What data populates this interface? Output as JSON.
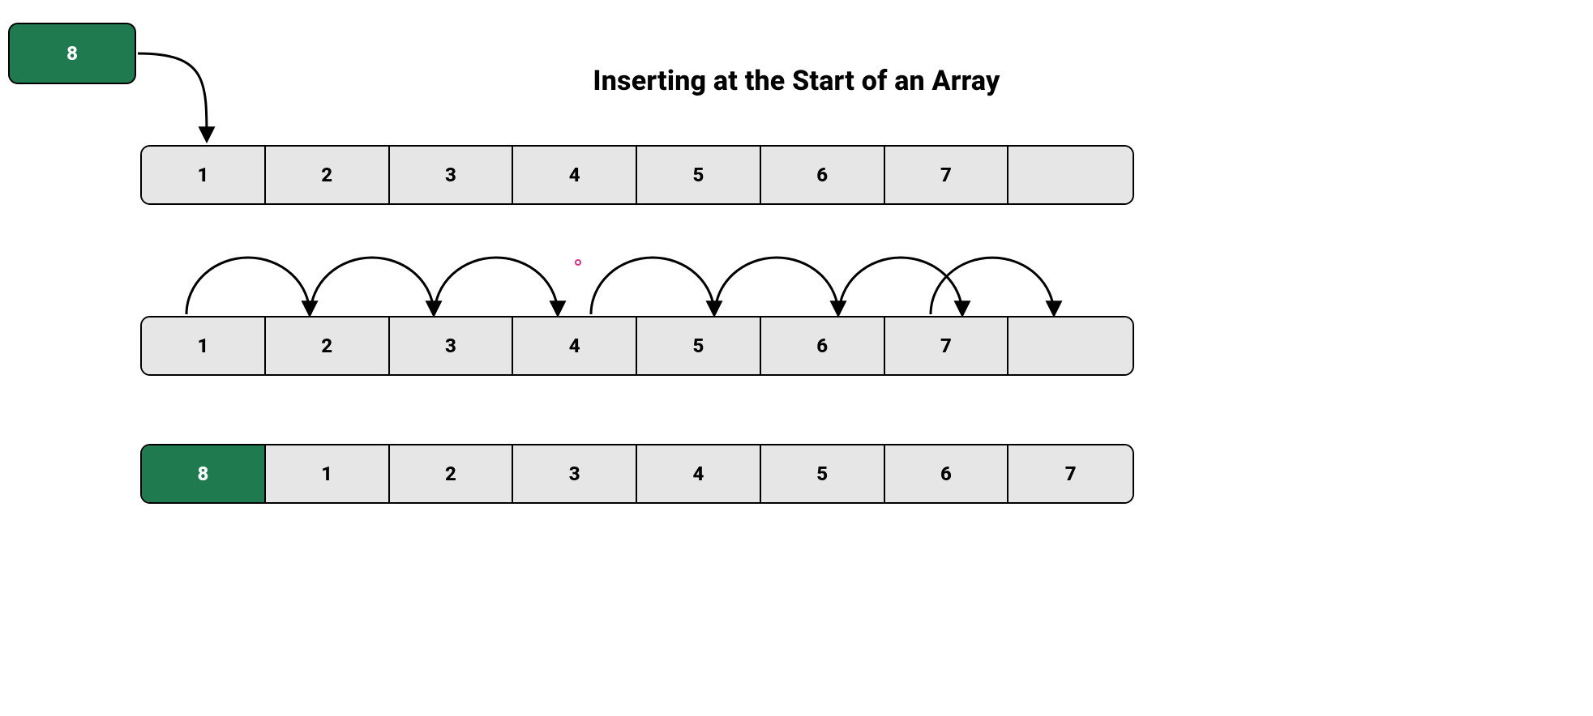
{
  "title": "Inserting at the Start of an Array",
  "newElement": "8",
  "row1": [
    "1",
    "2",
    "3",
    "4",
    "5",
    "6",
    "7",
    ""
  ],
  "row2": [
    "1",
    "2",
    "3",
    "4",
    "5",
    "6",
    "7",
    ""
  ],
  "row3": [
    "8",
    "1",
    "2",
    "3",
    "4",
    "5",
    "6",
    "7"
  ],
  "colors": {
    "green": "#1f7a50",
    "cellGray": "#e6e6e6",
    "pink": "#d63384"
  },
  "chart_data": {
    "type": "table",
    "title": "Inserting at the Start of an Array",
    "description": "Diagram showing three states of an 8-slot array when inserting value 8 at index 0. Row 1: initial array indices 0-6 hold 1-7, index 7 empty; new element 8 shown above with arrow into index 0. Row 2: same contents with shift arrows indicating each element moves one slot to the right. Row 3: result after insertion — index 0 holds 8, indices 1-7 hold 1-7.",
    "arrays": {
      "before": [
        1,
        2,
        3,
        4,
        5,
        6,
        7,
        null
      ],
      "during_shift": [
        1,
        2,
        3,
        4,
        5,
        6,
        7,
        null
      ],
      "after": [
        8,
        1,
        2,
        3,
        4,
        5,
        6,
        7
      ]
    },
    "inserted_value": 8,
    "insert_index": 0,
    "array_length": 8
  }
}
